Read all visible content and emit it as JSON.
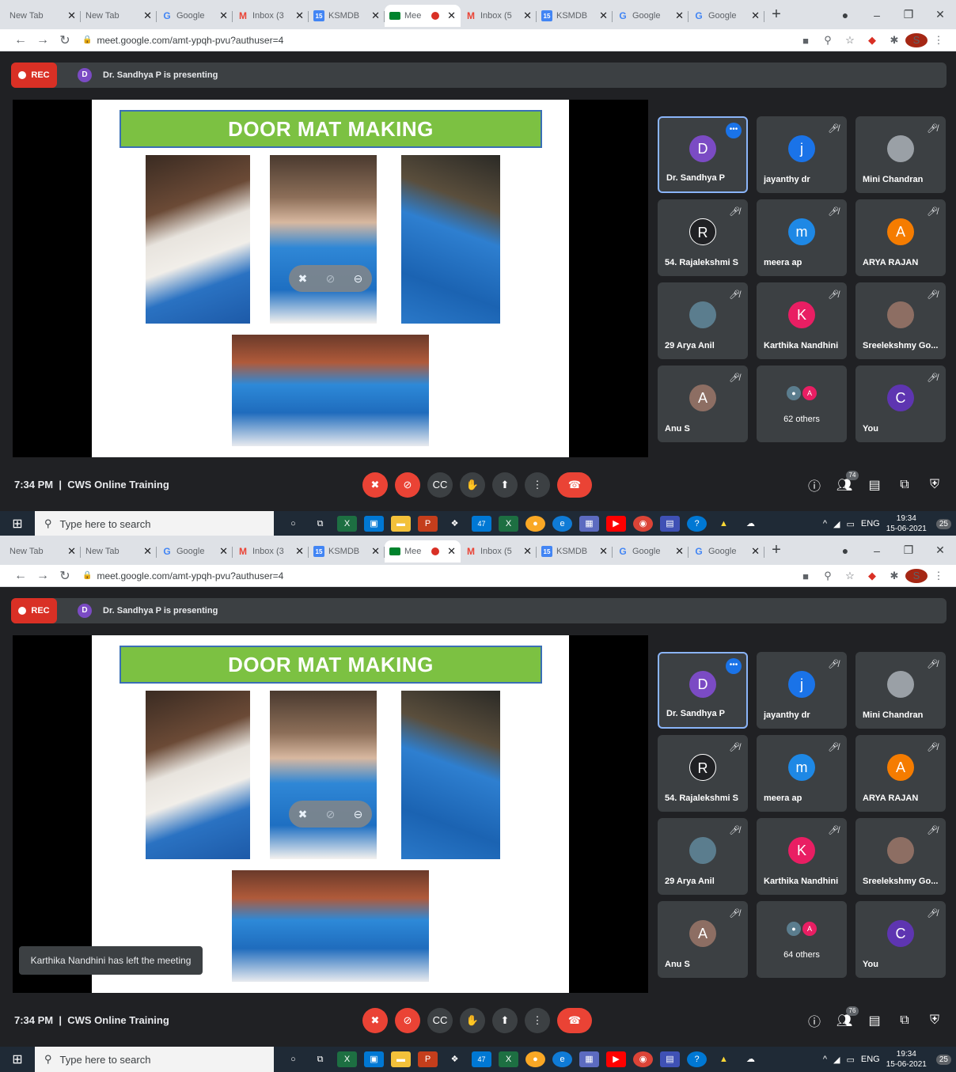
{
  "tabs": [
    {
      "label": "New Tab",
      "icon": "",
      "active": false
    },
    {
      "label": "New Tab",
      "icon": "",
      "active": false
    },
    {
      "label": "Google",
      "icon": "G",
      "active": false
    },
    {
      "label": "Inbox (3",
      "icon": "M",
      "active": false
    },
    {
      "label": "KSMDB",
      "icon": "15",
      "active": false
    },
    {
      "label": "Mee",
      "icon": "meet-icon",
      "active": true
    },
    {
      "label": "Inbox (5",
      "icon": "M",
      "active": false
    },
    {
      "label": "KSMDB",
      "icon": "15",
      "active": false
    },
    {
      "label": "Google",
      "icon": "G",
      "active": false
    },
    {
      "label": "Google",
      "icon": "G",
      "active": false
    }
  ],
  "url": "meet.google.com/amt-ypqh-pvu?authuser=4",
  "profile_initial": "S",
  "rec_label": "REC",
  "presenter_initial": "D",
  "presenting_text": "Dr. Sandhya P is presenting",
  "slide_title": "DOOR MAT MAKING",
  "participants": [
    {
      "name": "Dr. Sandhya P",
      "initial": "D",
      "color": "#7b4bc4",
      "speaking": true
    },
    {
      "name": "jayanthy dr",
      "initial": "j",
      "color": "#1a73e8",
      "speaking": false
    },
    {
      "name": "Mini Chandran",
      "initial": "",
      "color": "#9aa0a6",
      "speaking": false,
      "photo": true
    },
    {
      "name": "54. Rajalekshmi S",
      "initial": "R",
      "color": "#202124",
      "speaking": false
    },
    {
      "name": "meera ap",
      "initial": "m",
      "color": "#1e88e5",
      "speaking": false
    },
    {
      "name": "ARYA RAJAN",
      "initial": "A",
      "color": "#f57c00",
      "speaking": false
    },
    {
      "name": "29 Arya Anil",
      "initial": "",
      "color": "#5b7d8e",
      "speaking": false,
      "photo": true
    },
    {
      "name": "Karthika Nandhini",
      "initial": "K",
      "color": "#e91e63",
      "speaking": false
    },
    {
      "name": "Sreelekshmy Go...",
      "initial": "",
      "color": "#8d6e63",
      "speaking": false,
      "photo": true
    },
    {
      "name": "Anu S",
      "initial": "A",
      "color": "#8d6e63",
      "speaking": false
    },
    {
      "name": "others",
      "initial": "",
      "color": "",
      "speaking": false,
      "others": true
    },
    {
      "name": "You",
      "initial": "C",
      "color": "#5e35b1",
      "speaking": false
    }
  ],
  "screens": [
    {
      "others_text": "62 others",
      "people_count": "74",
      "toast": ""
    },
    {
      "others_text": "64 others",
      "people_count": "76",
      "toast": "Karthika Nandhini has left the meeting"
    }
  ],
  "meeting_time": "7:34 PM",
  "meeting_name": "CWS Online Training",
  "taskbar": {
    "search_placeholder": "Type here to search",
    "language": "ENG",
    "time": "19:34",
    "date": "15-06-2021",
    "notifications": "25",
    "mail_badge": "47"
  }
}
